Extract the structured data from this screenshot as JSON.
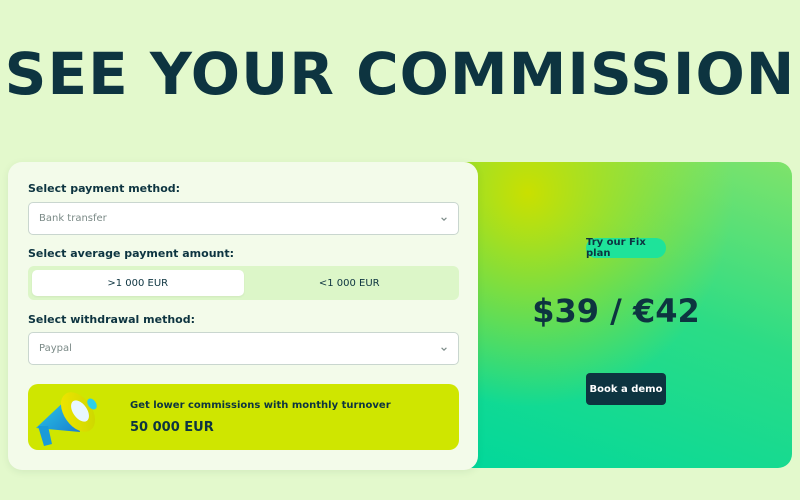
{
  "header": {
    "title": "SEE YOUR COMMISSION"
  },
  "form": {
    "payment_method": {
      "label": "Select payment method:",
      "value": "Bank transfer"
    },
    "average_amount": {
      "label": "Select average payment amount:",
      "options": [
        ">1 000 EUR",
        "<1 000 EUR"
      ],
      "selected": ">1 000 EUR"
    },
    "withdrawal_method": {
      "label": "Select withdrawal method:",
      "value": "Paypal"
    },
    "turnover": {
      "text": "Get lower commissions with monthly turnover",
      "amount": "50 000 EUR"
    }
  },
  "promo": {
    "badge": "Try our Fix plan",
    "price": "$39 / €42",
    "button": "Book a demo"
  },
  "colors": {
    "background": "#e3f9cc",
    "dark": "#0d3440",
    "lime": "#cfe600",
    "mint": "#1ee39a"
  },
  "icons": [
    "chevron-down-icon",
    "megaphone-icon"
  ]
}
